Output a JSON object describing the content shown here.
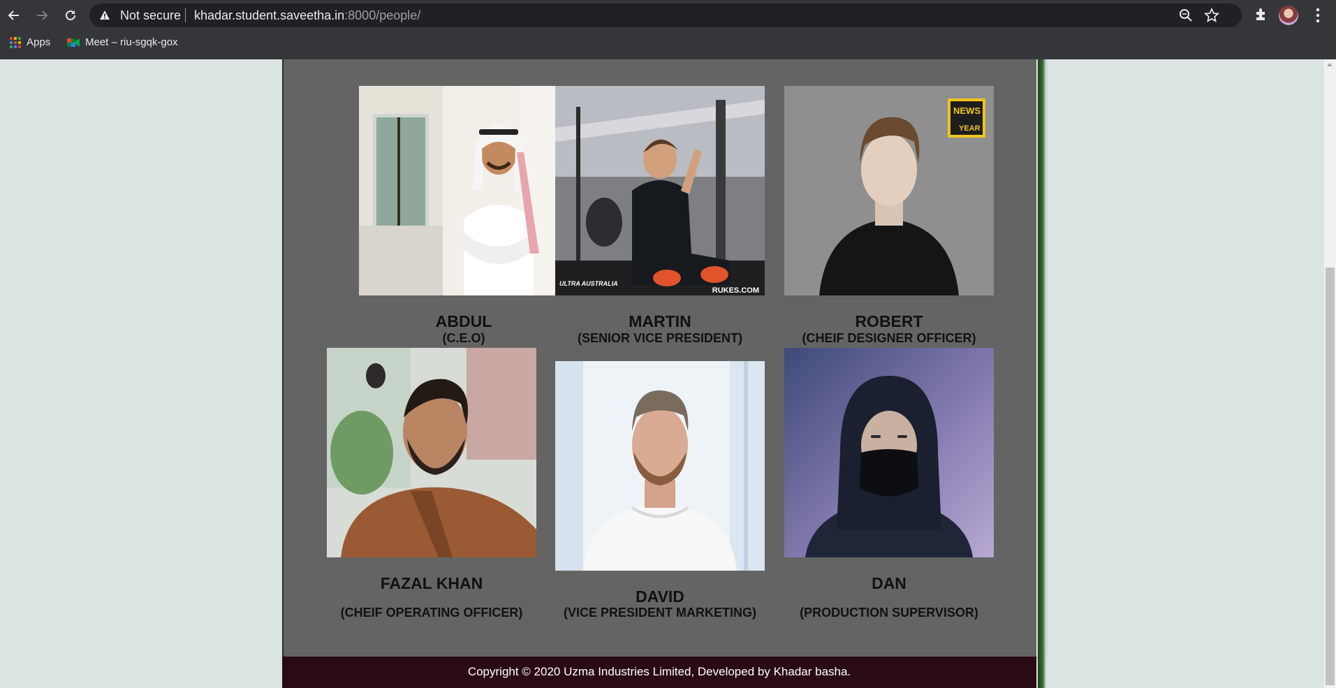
{
  "browser": {
    "security_label": "Not secure",
    "url_host": "khadar.student.saveetha.in",
    "url_rest": ":8000/people/",
    "bookmarks": [
      {
        "label": "Apps",
        "icon": "apps-grid-icon"
      },
      {
        "label": "Meet – riu-sgqk-gox",
        "icon": "google-meet-icon"
      }
    ]
  },
  "people": [
    {
      "name": "ABDUL",
      "role": "(C.E.O)",
      "photo": "portrait-man-white-thobe"
    },
    {
      "name": "MARTIN",
      "role": "(SENIOR VICE PRESIDENT)",
      "photo": "portrait-man-black-tshirt-seated",
      "photo_caption": "RUKES.COM",
      "photo_logo": "ULTRA AUSTRALIA"
    },
    {
      "name": "ROBERT",
      "role": "(CHEIF DESIGNER OFFICER)",
      "photo": "portrait-man-black-tshirt",
      "photo_badge": [
        "NEWS",
        "YEAR"
      ]
    },
    {
      "name": "FAZAL KHAN",
      "role": "(CHEIF OPERATING OFFICER)",
      "photo": "portrait-man-brown-shirt"
    },
    {
      "name": "DAVID",
      "role": "(VICE PRESIDENT MARKETING)",
      "photo": "portrait-man-white-tshirt"
    },
    {
      "name": "DAN",
      "role": "(PRODUCTION SUPERVISOR)",
      "photo": "portrait-man-black-hood-mask"
    }
  ],
  "footer": {
    "text": "Copyright © 2020 Uzma Industries Limited, Developed by Khadar basha."
  },
  "colors": {
    "card_bg": "#646464",
    "footer_bg": "#2a0b15",
    "page_bg": "#dae4e3"
  }
}
